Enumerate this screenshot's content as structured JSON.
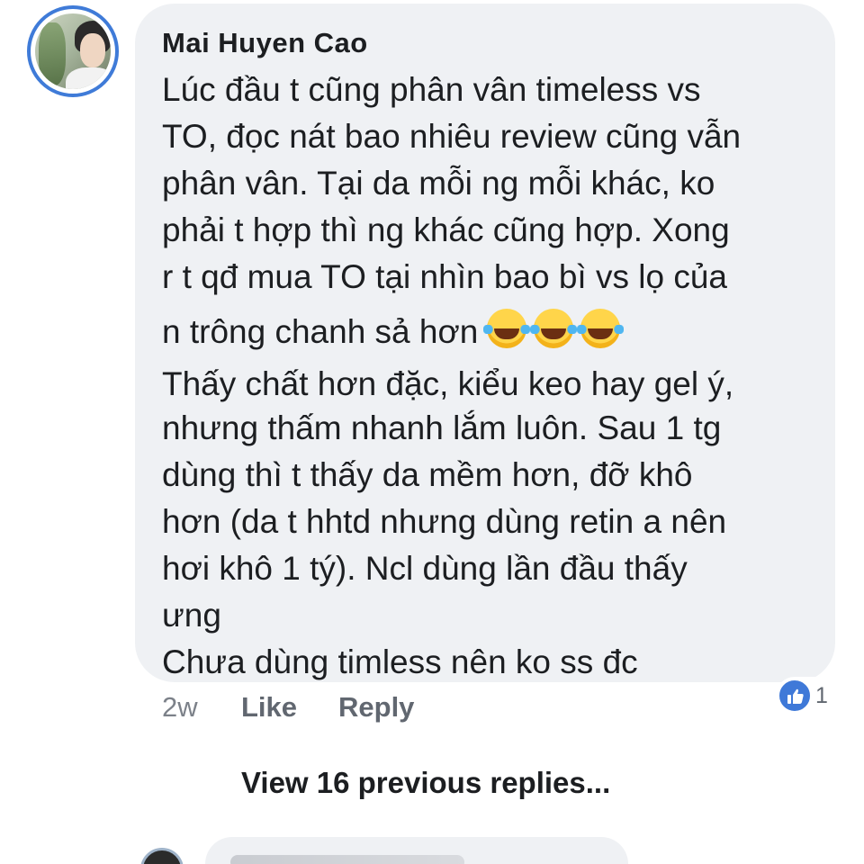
{
  "comment": {
    "author": "Mai Huyen Cao",
    "lines": [
      "Lúc đầu t cũng phân vân timeless vs",
      "TO, đọc nát bao nhiêu review cũng vẫn",
      "phân vân. Tại da mỗi ng mỗi khác, ko",
      "phải t hợp thì ng khác cũng hợp. Xong",
      "r t qđ mua TO tại nhìn bao bì vs lọ của",
      "n trông chanh sả hơn",
      "Thấy chất hơn đặc, kiểu keo hay gel ý,",
      "nhưng thấm nhanh lắm luôn. Sau 1 tg",
      "dùng thì t thấy da mềm hơn, đỡ khô",
      "hơn (da t hhtd nhưng dùng retin a nên",
      "hơi khô 1 tý). Ncl dùng lần đầu thấy",
      "ưng",
      "Chưa dùng timless nên ko ss đc"
    ],
    "emojis": [
      "face-with-tears-of-joy-icon",
      "face-with-tears-of-joy-icon",
      "face-with-tears-of-joy-icon"
    ],
    "time": "2w",
    "like_label": "Like",
    "reply_label": "Reply",
    "reaction_count": "1"
  },
  "view_previous_label": "View 16 previous replies...",
  "colors": {
    "bubble": "#eff1f4",
    "avatar_ring": "#3f7bd8",
    "like_reaction": "#3f79d8",
    "text": "#1c1e21",
    "muted": "#616770"
  }
}
